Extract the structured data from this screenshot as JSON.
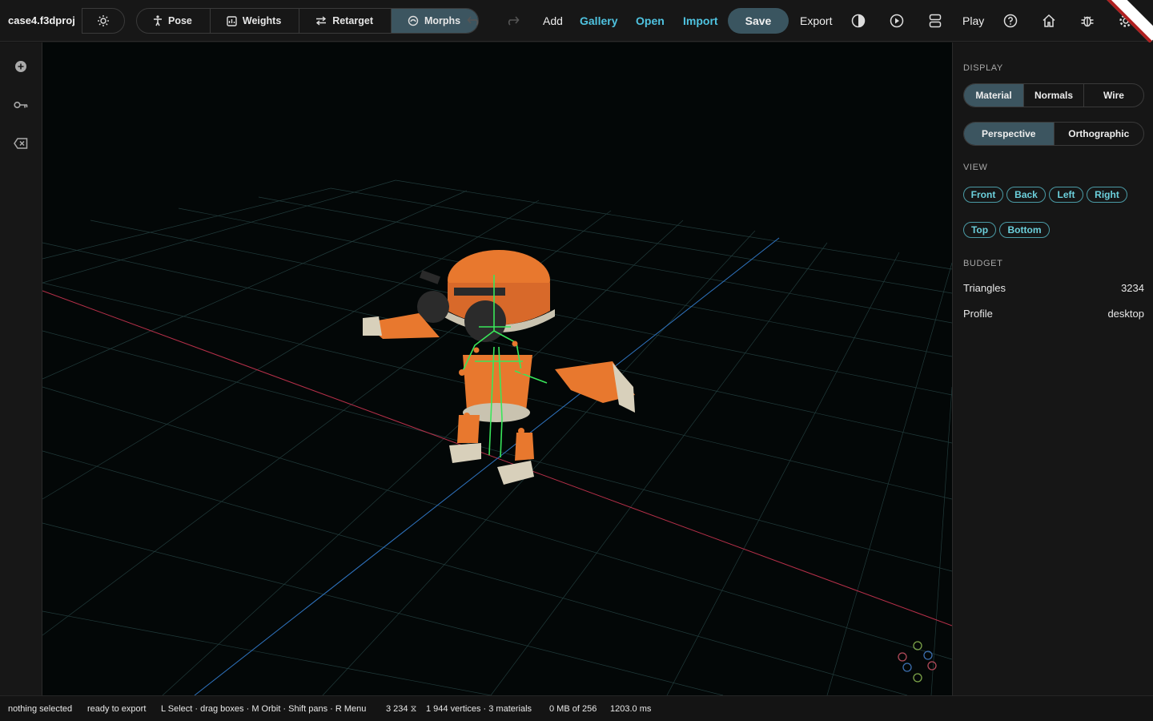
{
  "project": {
    "name": "case4.f3dproj"
  },
  "modes": [
    {
      "label": "Pose",
      "icon": "figure-icon"
    },
    {
      "label": "Weights",
      "icon": "weights-icon"
    },
    {
      "label": "Retarget",
      "icon": "arrows-swap-icon"
    },
    {
      "label": "Morphs",
      "icon": "morph-icon",
      "active": true
    }
  ],
  "toolbar": {
    "add": "Add",
    "gallery": "Gallery",
    "open": "Open",
    "import": "Import",
    "save": "Save",
    "export": "Export",
    "play": "Play",
    "accent_link": "#4fc3e0"
  },
  "panel": {
    "display_title": "DISPLAY",
    "display_modes": [
      "Material",
      "Normals",
      "Wire"
    ],
    "display_active": "Material",
    "projections": [
      "Perspective",
      "Orthographic"
    ],
    "projection_active": "Perspective",
    "view_title": "VIEW",
    "views_row1": [
      "Front",
      "Back",
      "Left",
      "Right"
    ],
    "views_row2": [
      "Top",
      "Bottom"
    ],
    "budget_title": "BUDGET",
    "triangles_label": "Triangles",
    "triangles_value": "3234",
    "profile_label": "Profile",
    "profile_value": "desktop"
  },
  "status": {
    "selection": "nothing selected",
    "export_state": "ready to export",
    "hints": "L Select · drag boxes · M Orbit · Shift pans · R Menu",
    "triangles": "3 234 ⧖",
    "geometry": "1 944 vertices · 3 materials",
    "memory": "0 MB of 256",
    "timing": "1203.0 ms"
  },
  "colors": {
    "accent": "#3c5560",
    "model": "#e8782e",
    "skeleton": "#39e65a"
  }
}
